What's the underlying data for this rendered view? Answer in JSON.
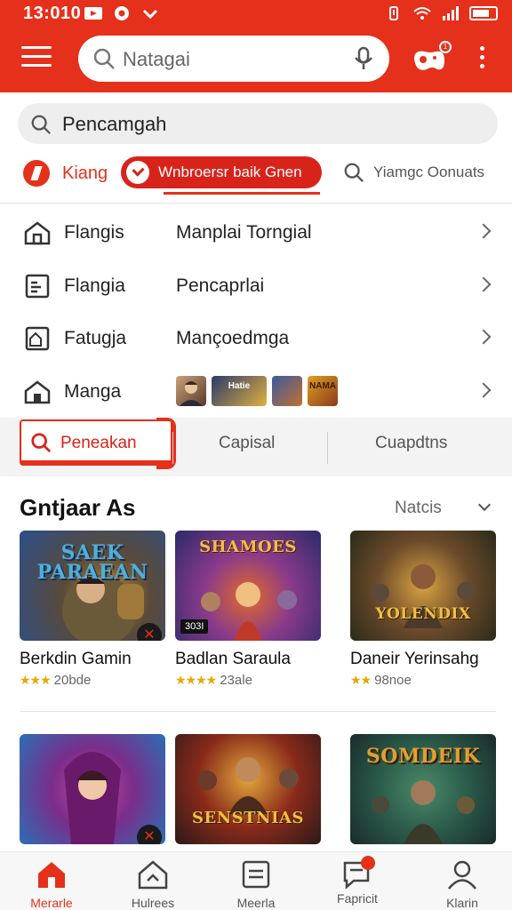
{
  "status_bar": {
    "time": "13:010"
  },
  "header": {
    "search_placeholder": "Natagai",
    "profile_badge": "1"
  },
  "secondary_search": {
    "value": "Pencamgah"
  },
  "chips": {
    "trending": "Kiang",
    "active": "Wnbroersr baik Gnen",
    "search": "Yiamgc Oonuats"
  },
  "menu_rows": [
    {
      "label": "Flangis",
      "value": "Manplai Torngial",
      "icon": "home-outline-icon"
    },
    {
      "label": "Flangia",
      "value": "Pencaprlai",
      "icon": "document-icon"
    },
    {
      "label": "Fatugja",
      "value": "Mançoedmga",
      "icon": "home-edit-icon"
    },
    {
      "label": "Manga",
      "value": "",
      "icon": "home-icon",
      "thumb_texts": [
        "",
        "Hatie",
        "",
        "NAMA"
      ]
    }
  ],
  "tabs": {
    "active": "Peneakan",
    "second": "Capisal",
    "third": "Cuapdtns"
  },
  "section": {
    "title": "Gntjaar As",
    "more": "Natcis"
  },
  "cards": [
    {
      "title_art": "SAEK PARAEAN",
      "name": "Berkdin Gamin",
      "rating_text": "20bde",
      "colors": [
        "#2b4f8a",
        "#c28a2c"
      ]
    },
    {
      "title_art": "SHAMOES",
      "name": "Badlan Saraula",
      "rating_text": "23ale",
      "tag": "303I",
      "colors": [
        "#5b2a7a",
        "#e06a2a"
      ]
    },
    {
      "title_art": "YOLENDIX",
      "name": "Daneir Yerinsahg",
      "rating_text": "98noe",
      "colors": [
        "#6b4a2a",
        "#d9a340"
      ]
    },
    {
      "title_art": "",
      "name": "",
      "rating_text": "",
      "colors": [
        "#7b2d8a",
        "#2a6fb5"
      ]
    },
    {
      "title_art": "SENSTNIAS",
      "name": "",
      "rating_text": "",
      "colors": [
        "#8a2a1a",
        "#e0a83a"
      ]
    },
    {
      "title_art": "SOMDEIK",
      "name": "",
      "rating_text": "",
      "colors": [
        "#2a5a4a",
        "#d8a23a"
      ]
    }
  ],
  "bottom_nav": [
    {
      "label": "Merarle",
      "icon": "home-icon",
      "active": true
    },
    {
      "label": "Hulrees",
      "icon": "home-outline-icon",
      "active": false
    },
    {
      "label": "Meerla",
      "icon": "list-icon",
      "active": false
    },
    {
      "label": "Fapricit",
      "icon": "message-icon",
      "active": false,
      "badge": true
    },
    {
      "label": "Klarin",
      "icon": "person-icon",
      "active": false
    }
  ],
  "colors": {
    "brand": "#e5301b",
    "star": "#e8a800"
  }
}
